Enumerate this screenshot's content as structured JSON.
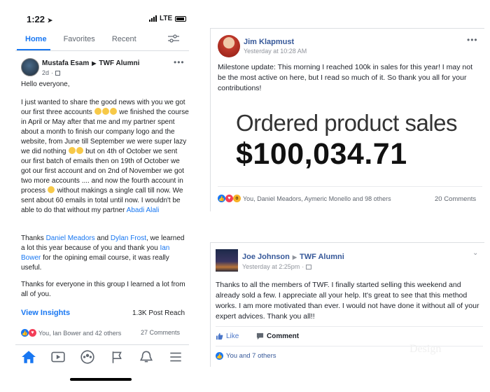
{
  "phone": {
    "status_time": "1:22",
    "network": "LTE",
    "tabs": [
      {
        "label": "Home",
        "active": true
      },
      {
        "label": "Favorites",
        "active": false
      },
      {
        "label": "Recent",
        "active": false
      }
    ],
    "post": {
      "author": "Mustafa Esam",
      "group": "TWF Alumni",
      "time": "2d",
      "greeting": "Hello everyone,",
      "p1_a": "I just wanted to share the good news with you we got our first three accounts",
      "p1_b": "we finished the course in April or May after that me and my partner spent about a month to finish our company logo and the website, from June till September we were super lazy we did nothing",
      "p1_c": "but on 4th of October we sent our first batch of emails then on 19th of October we got our first account and on 2nd of November we got two more accounts .... and now the fourth account in process",
      "p1_d": "without makings a single call till now. We sent about 60 emails in total until now. I wouldn't be able to do that without my partner",
      "partner": "Abadi Alali",
      "p2_a": "Thanks",
      "thanks_1": "Daniel Meadors",
      "p2_and": "and",
      "thanks_2": "Dylan Frost",
      "p2_b": ", we learned a lot this year because of you and thank you",
      "thanks_3": "Ian Bower",
      "p2_c": "for the opining email course, it was really useful.",
      "p3": "Thanks for everyone in this group I learned a lot from all of you.",
      "view_insights": "View Insights",
      "post_reach": "1.3K Post Reach",
      "reactions": "You, Ian Bower and 42 others",
      "comments": "27 Comments"
    },
    "nav": [
      "home-icon",
      "video-icon",
      "groups-icon",
      "flag-icon",
      "bell-icon",
      "menu-icon"
    ]
  },
  "card1": {
    "author": "Jim Klapmust",
    "time": "Yesterday at 10:28 AM",
    "text": "Milestone update: This morning I reached 100k in sales for this year! I may not be the most active on here, but I read so much of it. So thank you all for your contributions!",
    "image_label": "Ordered product sales",
    "image_value": "$100,034.71",
    "reactions": "You, Daniel Meadors, Aymeric Monello and 98 others",
    "comments": "20 Comments"
  },
  "card2": {
    "author": "Joe Johnson",
    "group": "TWF Alumni",
    "time": "Yesterday at 2:25pm",
    "text": "Thanks to all the members of TWF. I finally started selling this weekend and already sold a few. I appreciate all your help. It's great to see that this method works. I am more motivated than ever. I would not have done it without all of your expert advices. Thank you all!!",
    "like": "Like",
    "comment": "Comment",
    "reactions": "You and 7 others",
    "watermark": "Design"
  },
  "colors": {
    "accent": "#1877f2",
    "link": "#365899"
  }
}
